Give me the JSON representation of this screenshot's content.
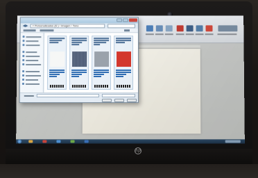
{
  "explorer": {
    "address": "« Personalizados (E:) › imagen › Tono"
  },
  "brand_logo": "hp",
  "colors": {
    "doc_page": "#f1efe6",
    "ribbon": "#e3e7eb",
    "explorer_bg": "#e6edf3",
    "close_button": "#c9463b",
    "taskbar": "#2d4a66",
    "red_swatch": "#d4382d"
  },
  "icons": [
    "back-arrow-icon",
    "search-icon",
    "close-icon",
    "start-orb-icon"
  ]
}
